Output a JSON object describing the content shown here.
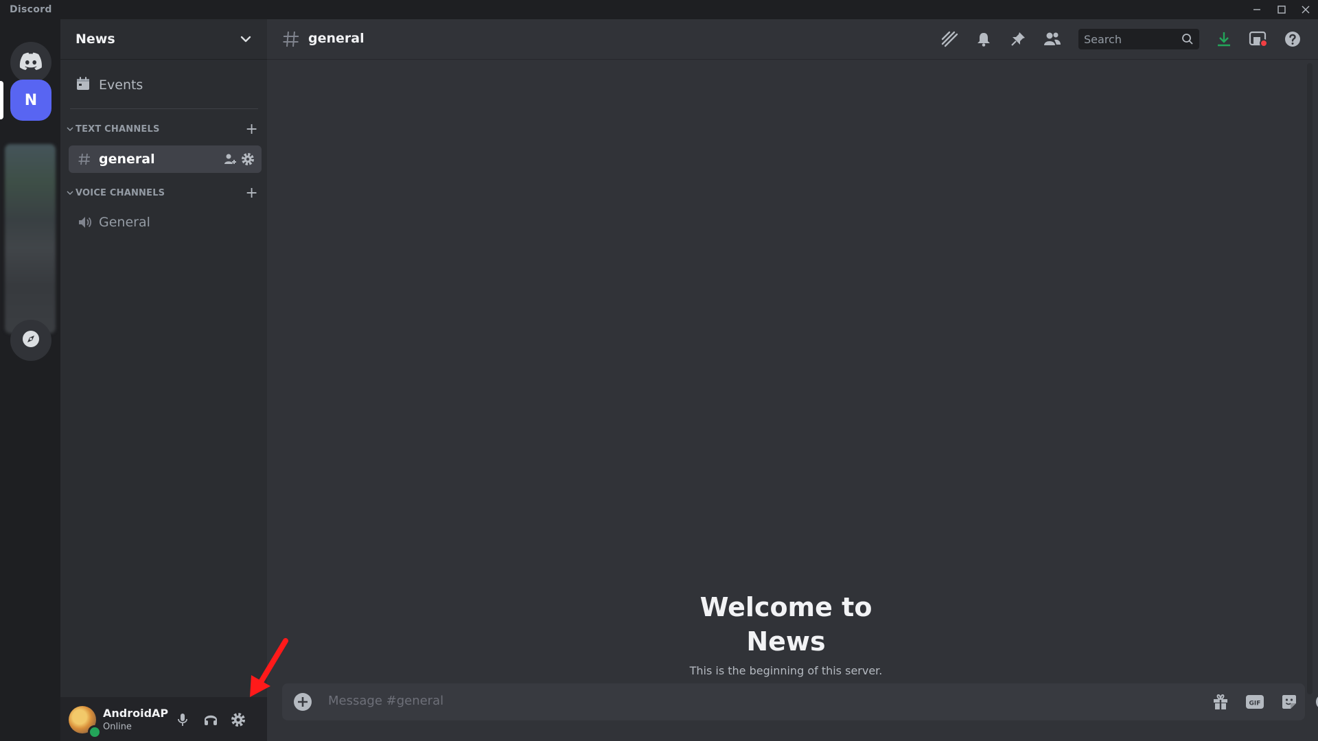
{
  "app": {
    "title": "Discord"
  },
  "window_controls": [
    "minimize-icon",
    "maximize-icon",
    "close-icon"
  ],
  "server_list": {
    "home": {
      "icon": "discord-logo-icon"
    },
    "servers": [
      {
        "initial": "N",
        "name": "News",
        "selected": true
      }
    ],
    "explore": {
      "icon": "compass-icon"
    }
  },
  "sidebar": {
    "server_name": "News",
    "events_label": "Events",
    "categories": [
      {
        "label": "TEXT CHANNELS",
        "channels": [
          {
            "name": "general",
            "type": "text",
            "active": true
          }
        ]
      },
      {
        "label": "VOICE CHANNELS",
        "channels": [
          {
            "name": "General",
            "type": "voice",
            "active": false
          }
        ]
      }
    ]
  },
  "user": {
    "name": "AndroidAP",
    "status": "Online",
    "status_color": "#23a55a"
  },
  "channel_header": {
    "name": "general",
    "icons": [
      "threads-icon",
      "bell-icon",
      "pin-icon",
      "members-icon",
      "download-icon",
      "inbox-icon",
      "help-icon"
    ],
    "search_placeholder": "Search"
  },
  "welcome": {
    "title": "Welcome to News",
    "subtitle": "This is the beginning of this server."
  },
  "composer": {
    "placeholder": "Message #general",
    "icons": [
      "gift-icon",
      "gif-icon",
      "sticker-icon",
      "emoji-icon"
    ]
  },
  "colors": {
    "accent": "#5865f2",
    "download": "#23a55a",
    "annotation_arrow": "#ff1a1a"
  }
}
